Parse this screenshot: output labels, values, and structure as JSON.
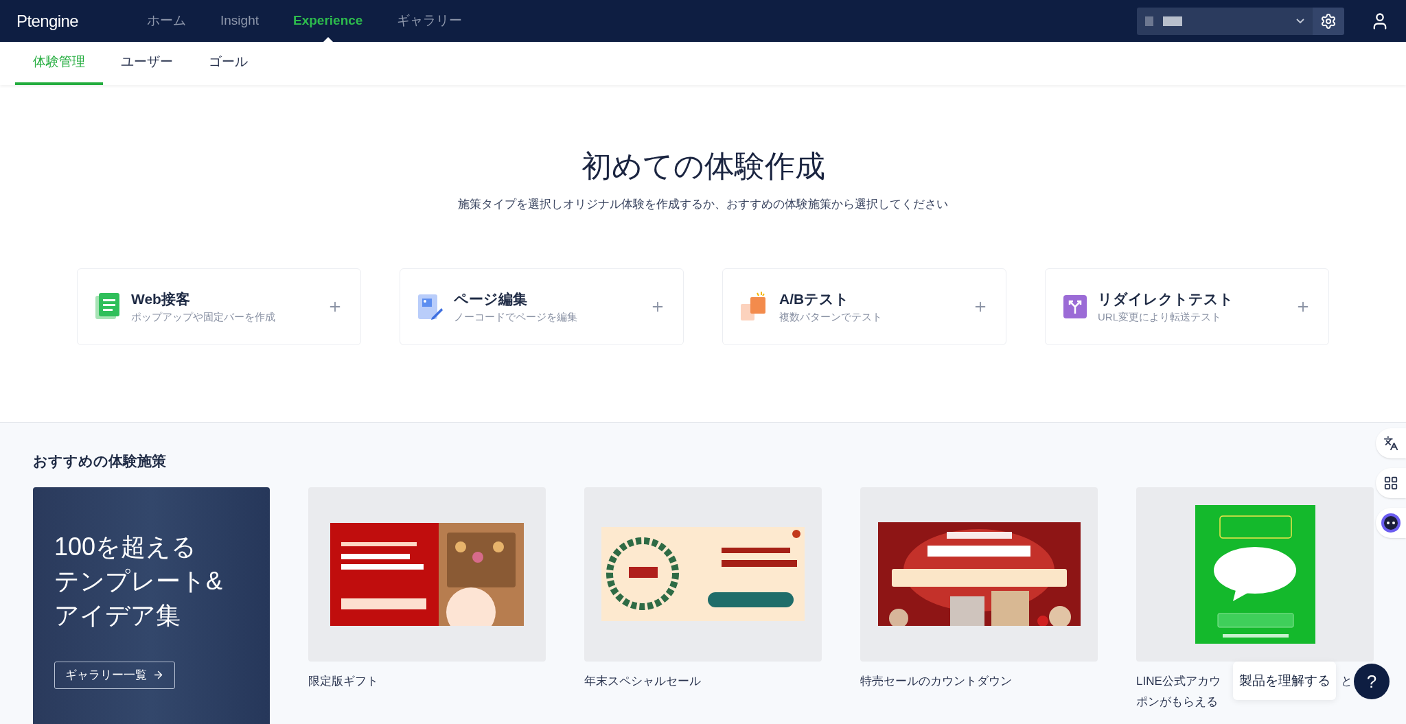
{
  "nav": {
    "logo": "Ptengine",
    "items": [
      {
        "label": "ホーム",
        "selected": false
      },
      {
        "label": "Insight",
        "selected": false
      },
      {
        "label": "Experience",
        "selected": true
      },
      {
        "label": "ギャラリー",
        "selected": false
      }
    ]
  },
  "subnav": {
    "tabs": [
      {
        "label": "体験管理",
        "selected": true
      },
      {
        "label": "ユーザー",
        "selected": false
      },
      {
        "label": "ゴール",
        "selected": false
      }
    ]
  },
  "hero": {
    "title": "初めての体験作成",
    "subtitle": "施策タイプを選択しオリジナル体験を作成するか、おすすめの体験施策から選択してください"
  },
  "experience_types": [
    {
      "kind": "popup",
      "title": "Web接客",
      "description": "ポップアップや固定バーを作成"
    },
    {
      "kind": "edit",
      "title": "ページ編集",
      "description": "ノーコードでページを編集"
    },
    {
      "kind": "ab",
      "title": "A/Bテスト",
      "description": "複数パターンでテスト"
    },
    {
      "kind": "redirect",
      "title": "リダイレクトテスト",
      "description": "URL変更により転送テスト"
    }
  ],
  "recommended": {
    "heading": "おすすめの体験施策",
    "promo": {
      "title_lines": [
        "100を超える",
        "テンプレート&",
        "アイデア集"
      ],
      "button": "ギャラリー一覧"
    },
    "templates": [
      {
        "kind": "gift",
        "title_lines": [
          [
            "限定版ギフト"
          ]
        ]
      },
      {
        "kind": "sale",
        "title_lines": [
          [
            "年末スペシャルセール"
          ]
        ]
      },
      {
        "kind": "countdown",
        "title_lines": [
          [
            "特売セールのカウントダウン"
          ]
        ]
      },
      {
        "kind": "line",
        "title_lines": [
          [
            "LINE公式アカウ",
            "と"
          ],
          [
            "ポンがもらえる"
          ]
        ]
      }
    ]
  },
  "help": {
    "tooltip": "製品を理解する",
    "button": "?"
  }
}
